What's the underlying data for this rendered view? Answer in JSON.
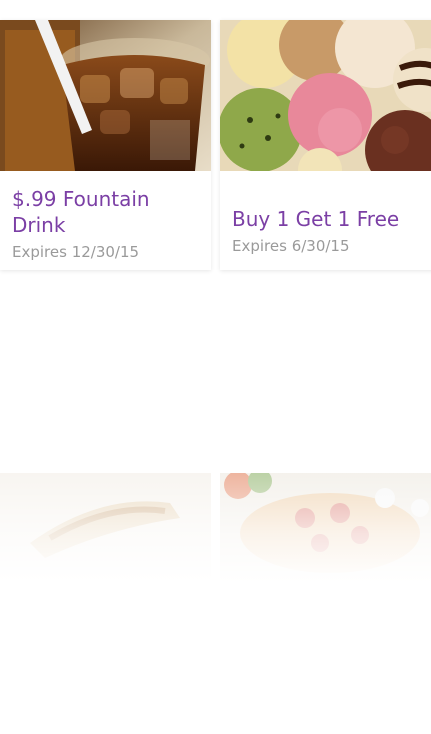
{
  "coupons": [
    {
      "title": "$.99 Fountain Drink",
      "expiry": "Expires 12/30/15",
      "image_icon": "soda-cup-image"
    },
    {
      "title": "Buy 1 Get 1 Free",
      "expiry": "Expires 6/30/15",
      "image_icon": "ice-cream-scoops-image"
    },
    {
      "title": "",
      "expiry": "",
      "image_icon": "hot-dog-image"
    },
    {
      "title": "",
      "expiry": "",
      "image_icon": "pizza-image"
    }
  ],
  "colors": {
    "title": "#7b3fa5",
    "expiry": "#9a9a9a",
    "background": "#ffffff"
  }
}
